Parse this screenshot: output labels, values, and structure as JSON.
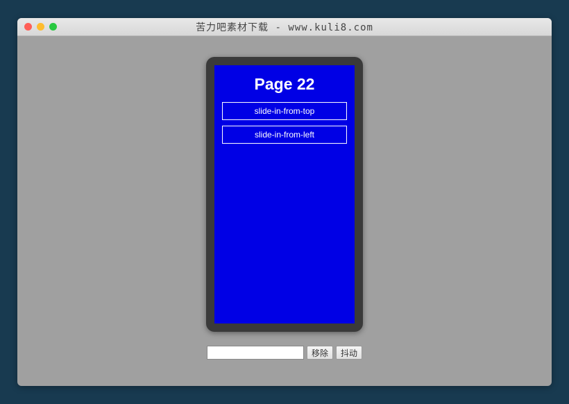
{
  "window": {
    "title": "苦力吧素材下载 - www.kuli8.com"
  },
  "phone": {
    "page_title": "Page 22",
    "buttons": [
      {
        "label": "slide-in-from-top"
      },
      {
        "label": "slide-in-from-left"
      }
    ]
  },
  "controls": {
    "input_value": "",
    "remove_label": "移除",
    "shake_label": "抖动"
  }
}
